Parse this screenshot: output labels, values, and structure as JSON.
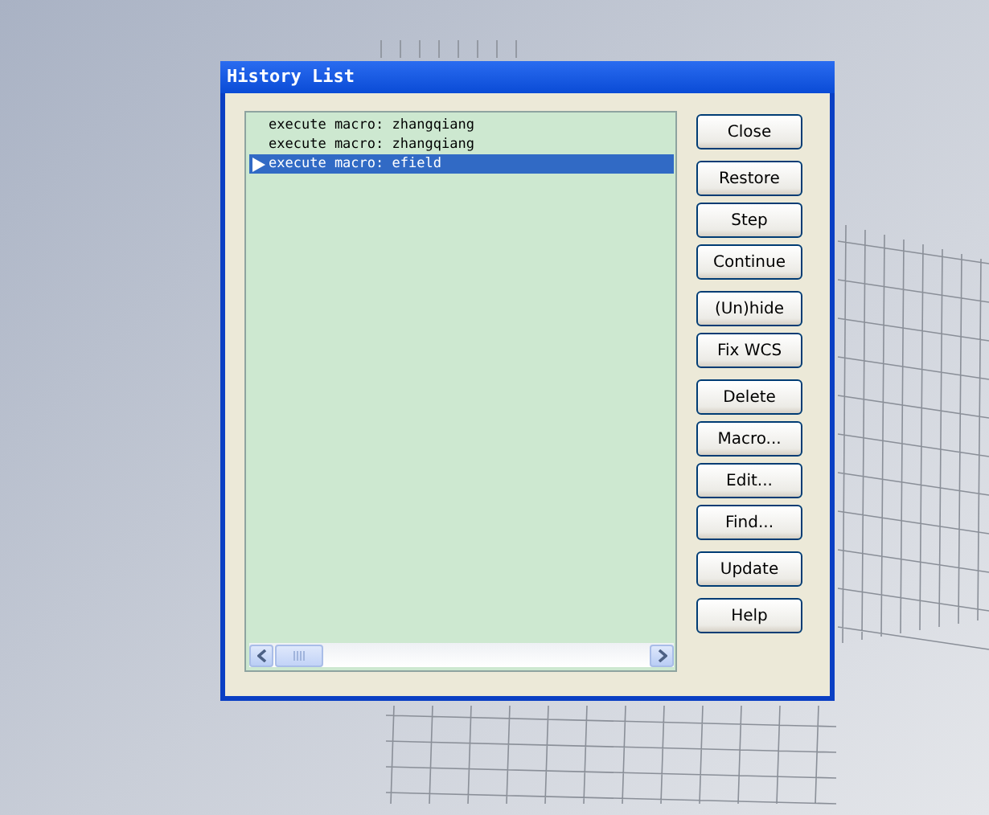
{
  "window": {
    "title": "History List"
  },
  "history": [
    {
      "text": "execute macro: zhangqiang",
      "selected": false
    },
    {
      "text": "execute macro: zhangqiang",
      "selected": false
    },
    {
      "text": "execute macro: efield",
      "selected": true
    }
  ],
  "button_groups": [
    [
      "Close"
    ],
    [
      "Restore",
      "Step",
      "Continue"
    ],
    [
      "(Un)hide",
      "Fix WCS"
    ],
    [
      "Delete",
      "Macro...",
      "Edit...",
      "Find..."
    ],
    [
      "Update"
    ],
    [
      "Help"
    ]
  ]
}
